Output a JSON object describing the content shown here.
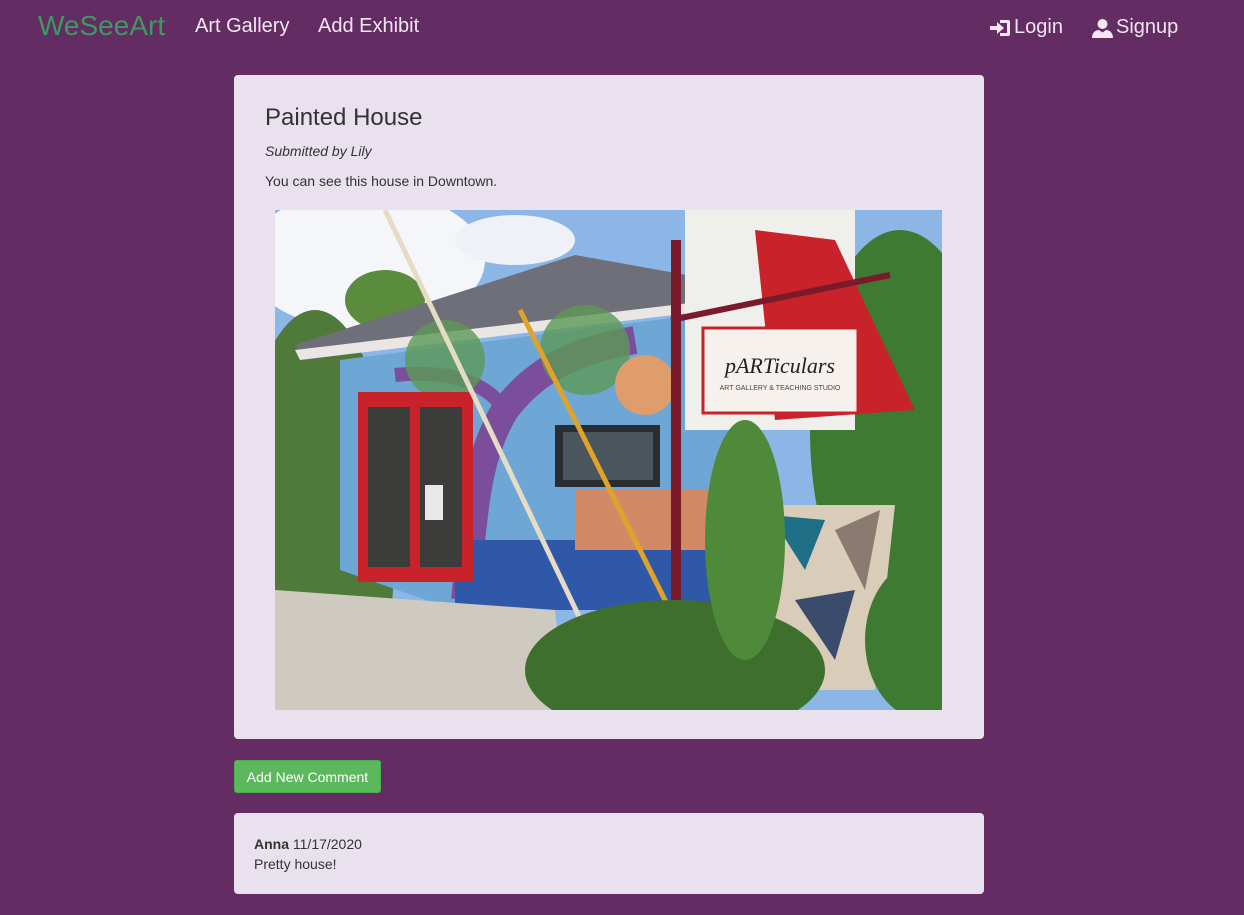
{
  "nav": {
    "brand": "WeSeeArt",
    "links": [
      "Art Gallery",
      "Add Exhibit"
    ],
    "login": "Login",
    "signup": "Signup",
    "login_icon": "log-in-icon",
    "signup_icon": "user-icon"
  },
  "exhibit": {
    "title": "Painted House",
    "submitted_by": "Submitted by Lily",
    "description": "You can see this house in Downtown.",
    "image_sign_text": "pARTiculars",
    "image_sign_subtext": "ART GALLERY & TEACHING STUDIO"
  },
  "add_comment_label": "Add New Comment",
  "comments": [
    {
      "author": "Anna",
      "date": "11/17/2020",
      "text": "Pretty house!"
    }
  ],
  "colors": {
    "background": "#632c63",
    "card": "#e9e1ed",
    "brand": "#3d9960",
    "button": "#5cb85c"
  }
}
